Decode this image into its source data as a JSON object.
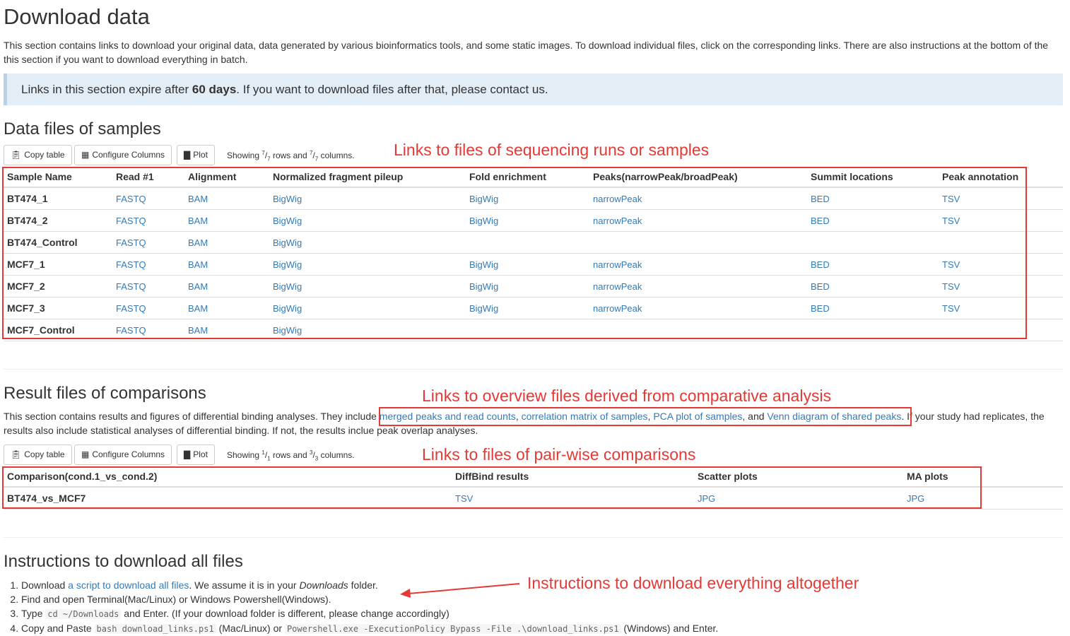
{
  "page_title": "Download data",
  "intro": "This section contains links to download your original data, data generated by various bioinformatics tools, and some static images. To download individual files, click on the corresponding links. There are also instructions at the bottom of the this section if you want to download everything in batch.",
  "alert": {
    "pre": "Links in this section expire after ",
    "bold": "60 days",
    "post": ". If you want to download files after that, please contact us."
  },
  "toolbar": {
    "copy": "Copy table",
    "configure": "Configure Columns",
    "plot": "Plot"
  },
  "samples": {
    "title": "Data files of samples",
    "showing": {
      "pre": "Showing ",
      "r_num": "7",
      "r_den": "7",
      "mid": " rows and ",
      "c_num": "7",
      "c_den": "7",
      "post": " columns."
    },
    "columns": [
      "Sample Name",
      "Read #1",
      "Alignment",
      "Normalized fragment pileup",
      "Fold enrichment",
      "Peaks(narrowPeak/broadPeak)",
      "Summit locations",
      "Peak annotation"
    ],
    "rows": [
      [
        "BT474_1",
        "FASTQ",
        "BAM",
        "BigWig",
        "BigWig",
        "narrowPeak",
        "BED",
        "TSV"
      ],
      [
        "BT474_2",
        "FASTQ",
        "BAM",
        "BigWig",
        "BigWig",
        "narrowPeak",
        "BED",
        "TSV"
      ],
      [
        "BT474_Control",
        "FASTQ",
        "BAM",
        "BigWig",
        "",
        "",
        "",
        ""
      ],
      [
        "MCF7_1",
        "FASTQ",
        "BAM",
        "BigWig",
        "BigWig",
        "narrowPeak",
        "BED",
        "TSV"
      ],
      [
        "MCF7_2",
        "FASTQ",
        "BAM",
        "BigWig",
        "BigWig",
        "narrowPeak",
        "BED",
        "TSV"
      ],
      [
        "MCF7_3",
        "FASTQ",
        "BAM",
        "BigWig",
        "BigWig",
        "narrowPeak",
        "BED",
        "TSV"
      ],
      [
        "MCF7_Control",
        "FASTQ",
        "BAM",
        "BigWig",
        "",
        "",
        "",
        ""
      ]
    ]
  },
  "comparisons": {
    "title": "Result files of comparisons",
    "desc": {
      "pre": "This section contains results and figures of differential binding analyses. They include ",
      "link1": "merged peaks and read counts",
      "sep1": ", ",
      "link2": "correlation matrix of samples",
      "sep2": ", ",
      "link3": "PCA plot of samples",
      "sep3": ", and ",
      "link4": "Venn diagram of shared peaks",
      "post": ". If your study had replicates, the results also include statistical analyses of differential binding. If not, the results inclue peak overlap analyses."
    },
    "showing": {
      "pre": "Showing ",
      "r_num": "1",
      "r_den": "1",
      "mid": " rows and ",
      "c_num": "3",
      "c_den": "3",
      "post": " columns."
    },
    "columns": [
      "Comparison(cond.1_vs_cond.2)",
      "DiffBind results",
      "Scatter plots",
      "MA plots"
    ],
    "rows": [
      [
        "BT474_vs_MCF7",
        "TSV",
        "JPG",
        "JPG"
      ]
    ]
  },
  "instructions": {
    "title": "Instructions to download all files",
    "step1": {
      "pre": "Download ",
      "link": "a script to download all files",
      "mid": ". We assume it is in your ",
      "em": "Downloads",
      "post": " folder."
    },
    "step2": "Find and open Terminal(Mac/Linux) or Windows Powershell(Windows).",
    "step3": {
      "pre": "Type ",
      "code": "cd ~/Downloads",
      "post": " and Enter. (If your download folder is different, please change accordingly)"
    },
    "step4": {
      "pre": "Copy and Paste ",
      "code1": "bash download_links.ps1",
      "mid": " (Mac/Linux) or ",
      "code2": "Powershell.exe -ExecutionPolicy Bypass -File .\\download_links.ps1",
      "post": " (Windows) and Enter."
    }
  },
  "annotations": {
    "samples": "Links to files of sequencing runs or samples",
    "overview": "Links to overview files derived from comparative analysis",
    "pairwise": "Links to files of pair-wise comparisons",
    "instructions": "Instructions to download everything altogether"
  },
  "colors": {
    "annotation": "#e53935",
    "link": "#337ab7",
    "alert_bg": "#e3edf6"
  },
  "icons": {
    "copy": "copy-icon",
    "configure": "grid-icon",
    "plot": "bar-chart-icon"
  }
}
